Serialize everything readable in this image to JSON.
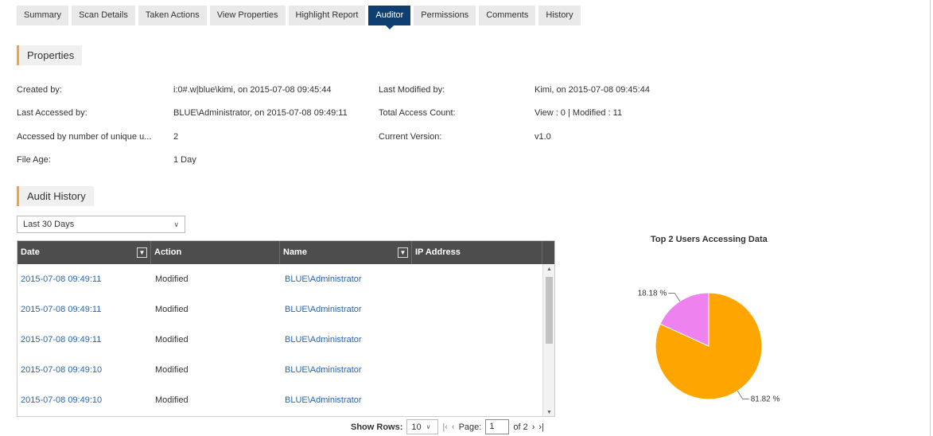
{
  "tabs": [
    {
      "label": "Summary",
      "active": false
    },
    {
      "label": "Scan Details",
      "active": false
    },
    {
      "label": "Taken Actions",
      "active": false
    },
    {
      "label": "View Properties",
      "active": false
    },
    {
      "label": "Highlight Report",
      "active": false
    },
    {
      "label": "Auditor",
      "active": true
    },
    {
      "label": "Permissions",
      "active": false
    },
    {
      "label": "Comments",
      "active": false
    },
    {
      "label": "History",
      "active": false
    }
  ],
  "properties": {
    "header": "Properties",
    "created_by": {
      "label": "Created by:",
      "value": "i:0#.w|blue\\kimi, on 2015-07-08 09:45:44"
    },
    "last_modified_by": {
      "label": "Last Modified by:",
      "value": "Kimi, on 2015-07-08 09:45:44"
    },
    "last_accessed_by": {
      "label": "Last Accessed by:",
      "value": "BLUE\\Administrator, on 2015-07-08 09:49:11"
    },
    "total_access_count": {
      "label": "Total Access Count:",
      "value": "View : 0 | Modified : 11"
    },
    "unique_users": {
      "label": "Accessed by number of unique u...",
      "value": "2"
    },
    "current_version": {
      "label": "Current Version:",
      "value": "v1.0"
    },
    "file_age": {
      "label": "File Age:",
      "value": "1 Day"
    }
  },
  "audit": {
    "header": "Audit History",
    "range_selected": "Last 30 Days",
    "columns": [
      "Date",
      "Action",
      "Name",
      "IP Address"
    ],
    "rows": [
      {
        "date": "2015-07-08 09:49:11",
        "action": "Modified",
        "name": "BLUE\\Administrator",
        "ip": ""
      },
      {
        "date": "2015-07-08 09:49:11",
        "action": "Modified",
        "name": "BLUE\\Administrator",
        "ip": ""
      },
      {
        "date": "2015-07-08 09:49:11",
        "action": "Modified",
        "name": "BLUE\\Administrator",
        "ip": ""
      },
      {
        "date": "2015-07-08 09:49:10",
        "action": "Modified",
        "name": "BLUE\\Administrator",
        "ip": ""
      },
      {
        "date": "2015-07-08 09:49:10",
        "action": "Modified",
        "name": "BLUE\\Administrator",
        "ip": ""
      }
    ],
    "pager": {
      "show_rows_label": "Show Rows:",
      "rows_value": "10",
      "page_label": "Page:",
      "page_value": "1",
      "of_label": "of 2"
    }
  },
  "chart": {
    "title": "Top 2 Users Accessing Data",
    "chart_data": {
      "type": "pie",
      "slices": [
        {
          "value": 81.82,
          "label": "81.82 %",
          "color": "#ffa500"
        },
        {
          "value": 18.18,
          "label": "18.18 %",
          "color": "#ee82ee"
        }
      ]
    }
  }
}
